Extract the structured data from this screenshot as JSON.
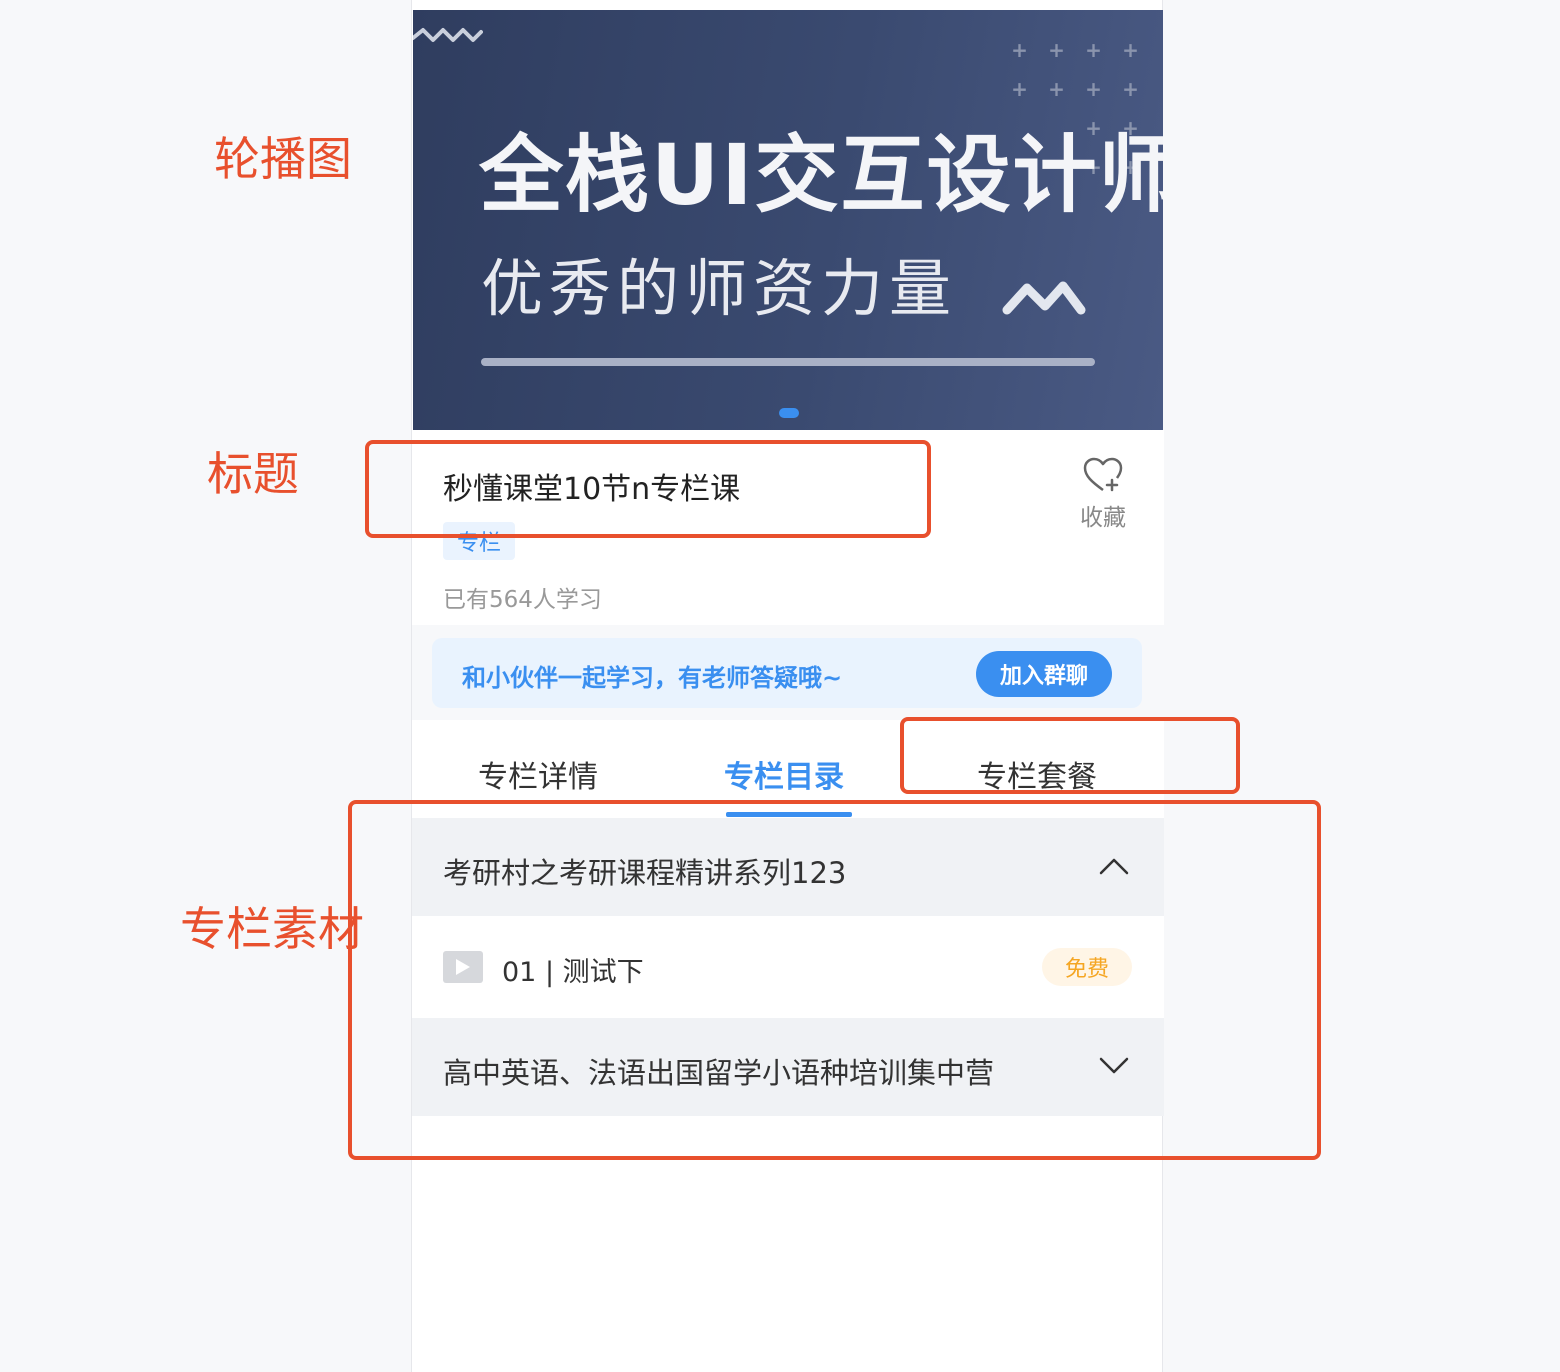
{
  "annotations": {
    "carousel": "轮播图",
    "title": "标题",
    "materials": "专栏素材"
  },
  "banner": {
    "title": "全栈UI交互设计师",
    "subtitle": "优秀的师资力量",
    "active_index": 1,
    "total": 1
  },
  "course": {
    "title": "秒懂课堂10节n专栏课",
    "tag": "专栏",
    "learners": "已有564人学习",
    "collect_label": "收藏"
  },
  "community": {
    "text": "和小伙伴一起学习，有老师答疑哦~",
    "join_button": "加入群聊"
  },
  "tabs": {
    "items": [
      "专栏详情",
      "专栏目录",
      "专栏套餐"
    ],
    "active": "专栏目录"
  },
  "catalog": {
    "sections": [
      {
        "title": "考研村之考研课程精讲系列123",
        "expanded": true,
        "lessons": [
          {
            "title": "01 | 测试下",
            "badge": "免费",
            "icon": "play-icon"
          }
        ]
      },
      {
        "title": "高中英语、法语出国留学小语种培训集中营",
        "expanded": false,
        "lessons": []
      }
    ]
  },
  "colors": {
    "accent": "#3a8ff0",
    "annotation": "#e8502d",
    "free": "#f5a623"
  }
}
